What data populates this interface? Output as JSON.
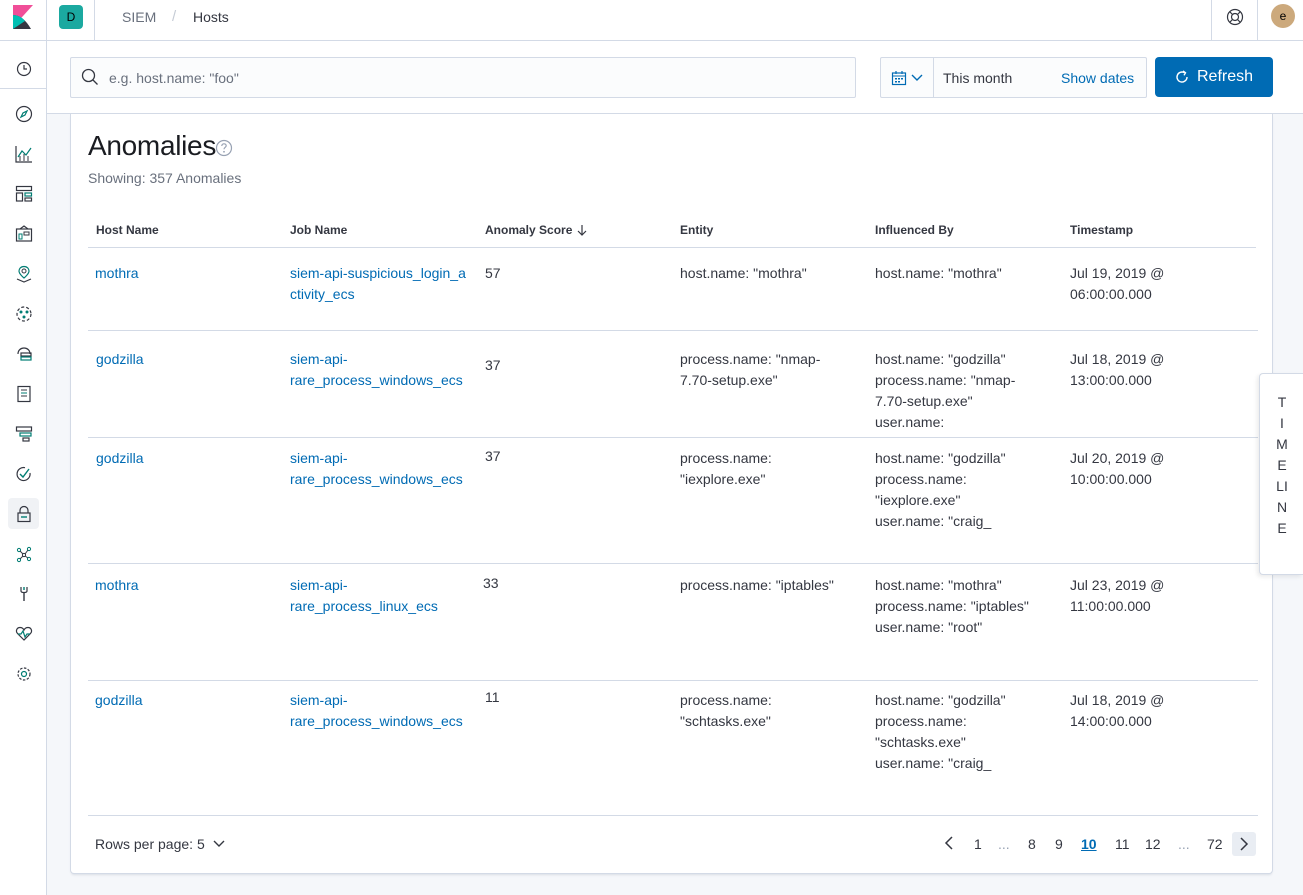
{
  "header": {
    "space_initial": "D",
    "breadcrumbs": [
      "SIEM",
      "Hosts"
    ],
    "breadcrumb_separator": "/",
    "user_initial": "e"
  },
  "nav": {
    "items": [
      "recently-viewed",
      "discover",
      "visualize",
      "dashboard",
      "canvas",
      "maps",
      "machine-learning",
      "infrastructure",
      "logs",
      "apm",
      "uptime",
      "siem",
      "graph",
      "dev-tools",
      "monitoring",
      "management"
    ],
    "active": "siem"
  },
  "search": {
    "placeholder": "e.g. host.name: \"foo\""
  },
  "date_picker": {
    "range_label": "This month",
    "show_dates_label": "Show dates"
  },
  "refresh_label": "Refresh",
  "anomalies": {
    "title": "Anomalies",
    "subtitle": "Showing: 357 Anomalies",
    "columns": {
      "host": "Host Name",
      "job": "Job Name",
      "score": "Anomaly Score",
      "entity": "Entity",
      "influenced": "Influenced By",
      "timestamp": "Timestamp"
    },
    "rows": [
      {
        "host": "mothra",
        "job": "siem-api-suspicious_login_activity_ecs",
        "score": "57",
        "entity": "host.name: \"mothra\"",
        "influenced": "host.name: \"mothra\"",
        "timestamp": "Jul 19, 2019 @ 06:00:00.000"
      },
      {
        "host": "godzilla",
        "job": "siem-api-rare_process_windows_ecs",
        "score": "37",
        "entity": "process.name: \"nmap-7.70-setup.exe\"",
        "influenced": "host.name: \"godzilla\" process.name: \"nmap-7.70-setup.exe\" user.name:",
        "timestamp": "Jul 18, 2019 @ 13:00:00.000"
      },
      {
        "host": "godzilla",
        "job": "siem-api-rare_process_windows_ecs",
        "score": "37",
        "entity": "process.name: \"iexplore.exe\"",
        "influenced": "host.name: \"godzilla\" process.name: \"iexplore.exe\" user.name: \"craig_",
        "timestamp": "Jul 20, 2019 @ 10:00:00.000"
      },
      {
        "host": "mothra",
        "job": "siem-api-rare_process_linux_ecs",
        "score": "33",
        "entity": "process.name: \"iptables\"",
        "influenced": "host.name: \"mothra\" process.name: \"iptables\" user.name: \"root\"",
        "timestamp": "Jul 23, 2019 @ 11:00:00.000"
      },
      {
        "host": "godzilla",
        "job": "siem-api-rare_process_windows_ecs",
        "score": "11",
        "entity": "process.name: \"schtasks.exe\"",
        "influenced": "host.name: \"godzilla\" process.name: \"schtasks.exe\" user.name: \"craig_",
        "timestamp": "Jul 18, 2019 @ 14:00:00.000"
      }
    ],
    "rows_per_page_label": "Rows per page: 5",
    "pagination": [
      "1",
      "...",
      "8",
      "9",
      "10",
      "11",
      "12",
      "...",
      "72"
    ],
    "current_page": "10"
  },
  "timeline_label": "TIMELINE"
}
